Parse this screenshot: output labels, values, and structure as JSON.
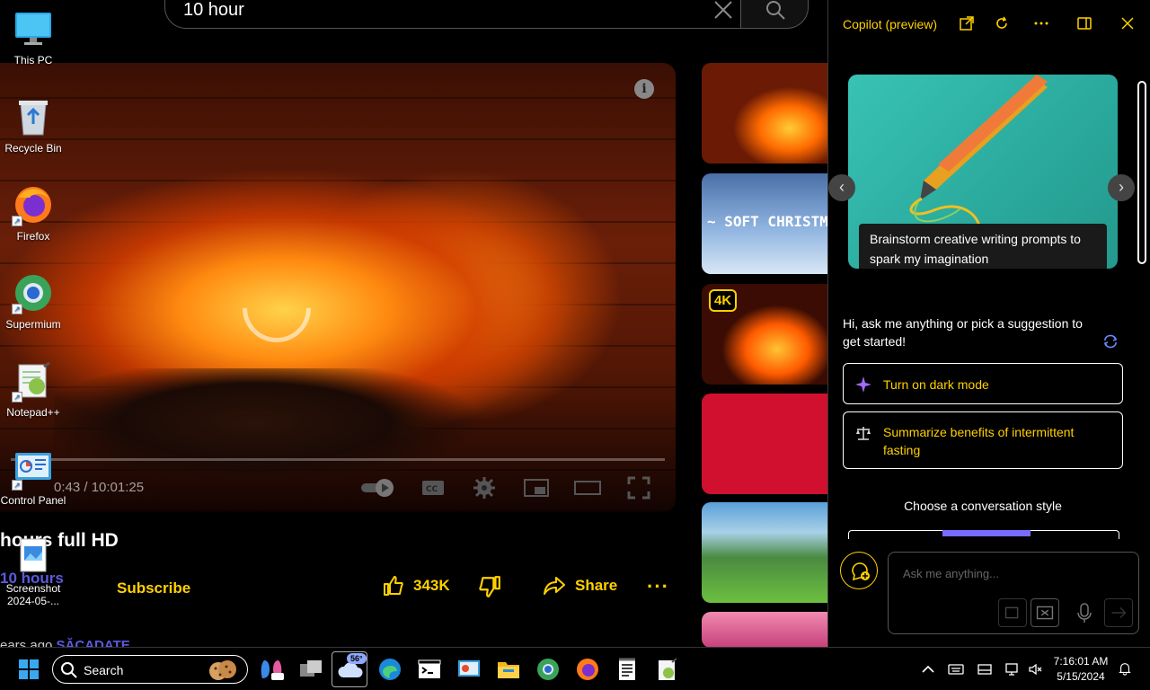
{
  "youtube": {
    "search_query": "10 hour",
    "player": {
      "time": "0:43 / 10:01:25"
    },
    "video_title": "hours full HD",
    "channel": "10 hours",
    "subscribe_label": "Subscribe",
    "like_count": "343K",
    "share_label": "Share",
    "more_label": "···",
    "meta_prefix": "ears ago",
    "meta_tag": "SĂCADATE",
    "recommended": [
      {
        "overlay_text": ""
      },
      {
        "overlay_text": "~ SOFT CHRISTM"
      },
      {
        "overlay_text": "4K"
      },
      {
        "overlay_text": ""
      },
      {
        "overlay_text": ""
      },
      {
        "overlay_text": ""
      }
    ]
  },
  "desktop_icons": [
    {
      "label": "This PC"
    },
    {
      "label": "Recycle Bin"
    },
    {
      "label": "Firefox"
    },
    {
      "label": "Supermium"
    },
    {
      "label": "Notepad++"
    },
    {
      "label": "Control Panel"
    },
    {
      "label": "Screenshot 2024-05-..."
    }
  ],
  "copilot": {
    "title": "Copilot (preview)",
    "carousel_caption": "Brainstorm creative writing prompts to spark my imagination",
    "greeting": "Hi, ask me anything or pick a suggestion to get started!",
    "suggestions": [
      {
        "label": "Turn on dark mode"
      },
      {
        "label": "Summarize benefits of intermittent fasting"
      }
    ],
    "conversation_style_label": "Choose a conversation style",
    "input_placeholder": "Ask me anything..."
  },
  "taskbar": {
    "search_label": "Search",
    "weather_temp": "56°",
    "time": "7:16:01 AM",
    "date": "5/15/2024"
  },
  "colors": {
    "accent_yellow": "#ffd100",
    "channel_blue": "#5a5adf",
    "style_active": "#7a6cff"
  }
}
